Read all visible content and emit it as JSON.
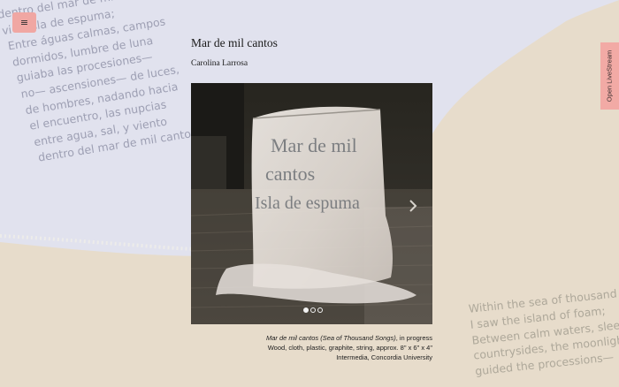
{
  "colors": {
    "page_beige": "#e7dccb",
    "blob_lavender": "#e1e2ee",
    "menu_pink": "#f0a7a3",
    "livestream_pink": "#f2aaa5"
  },
  "menu": {
    "icon": "hamburger-icon",
    "glyph": "≡"
  },
  "livestream": {
    "label": "Open LiveStream"
  },
  "poem_es": {
    "lines": [
      "dentro del mar de mil cantos",
      "vi la isla de espuma;",
      "Entre águas calmas, campos",
      "dormidos, lumbre de luna",
      "guiaba las procesiones—",
      "no— ascensiones— de luces,",
      "de hombres, nadando hacia",
      "el encuentro, las nupcias",
      "entre agua, sal, y viento",
      "dentro del mar de mil cantos"
    ]
  },
  "poem_en": {
    "lines": [
      "Within the sea of thousand songs",
      "I saw the island of foam;",
      "Between calm waters, sleeping",
      "countrysides, the moonlight",
      "guided the processions—"
    ]
  },
  "artwork": {
    "title": "Mar de mil cantos",
    "author": "Carolina Larrosa",
    "photo_text": [
      "Mar de mil",
      "cantos",
      "Isla de espuma"
    ],
    "carousel": {
      "slides": 3,
      "current": 1,
      "next_icon": "chevron-right-icon"
    },
    "caption": {
      "title_italic": "Mar de mil cantos (Sea of Thousand Songs)",
      "status": ", in progress",
      "materials": "Wood, cloth, plastic, graphite, string, approx. 8\" x 6\" x 4\"",
      "venue": "Intermedia, Concordia University"
    }
  }
}
